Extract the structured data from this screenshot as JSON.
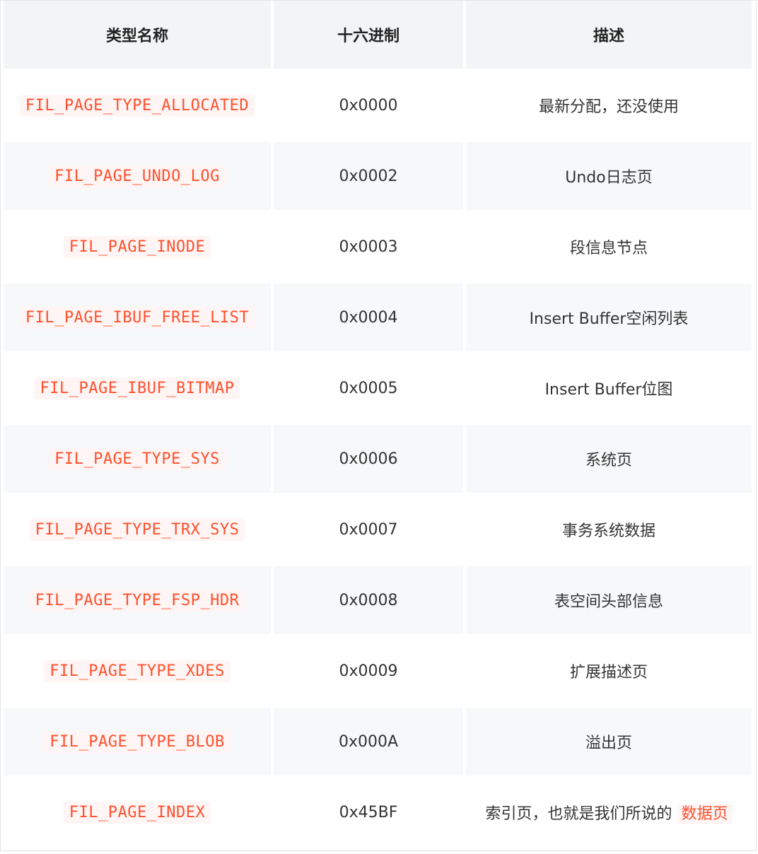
{
  "headers": [
    "类型名称",
    "十六进制",
    "描述"
  ],
  "rows": [
    {
      "name": "FIL_PAGE_TYPE_ALLOCATED",
      "hex": "0x0000",
      "desc": "最新分配，还没使用"
    },
    {
      "name": "FIL_PAGE_UNDO_LOG",
      "hex": "0x0002",
      "desc": "Undo日志页"
    },
    {
      "name": "FIL_PAGE_INODE",
      "hex": "0x0003",
      "desc": "段信息节点"
    },
    {
      "name": "FIL_PAGE_IBUF_FREE_LIST",
      "hex": "0x0004",
      "desc": "Insert Buffer空闲列表"
    },
    {
      "name": "FIL_PAGE_IBUF_BITMAP",
      "hex": "0x0005",
      "desc": "Insert Buffer位图"
    },
    {
      "name": "FIL_PAGE_TYPE_SYS",
      "hex": "0x0006",
      "desc": "系统页"
    },
    {
      "name": "FIL_PAGE_TYPE_TRX_SYS",
      "hex": "0x0007",
      "desc": "事务系统数据"
    },
    {
      "name": "FIL_PAGE_TYPE_FSP_HDR",
      "hex": "0x0008",
      "desc": "表空间头部信息"
    },
    {
      "name": "FIL_PAGE_TYPE_XDES",
      "hex": "0x0009",
      "desc": "扩展描述页"
    },
    {
      "name": "FIL_PAGE_TYPE_BLOB",
      "hex": "0x000A",
      "desc": "溢出页"
    },
    {
      "name": "FIL_PAGE_INDEX",
      "hex": "0x45BF",
      "desc": "索引页，也就是我们所说的",
      "desc_highlight": "数据页"
    }
  ],
  "colors": {
    "code_text": "#ff502c",
    "code_bg": "#fff5f5",
    "header_bg": "#f3f4f5",
    "row_alt_bg": "#f7f8f9"
  }
}
